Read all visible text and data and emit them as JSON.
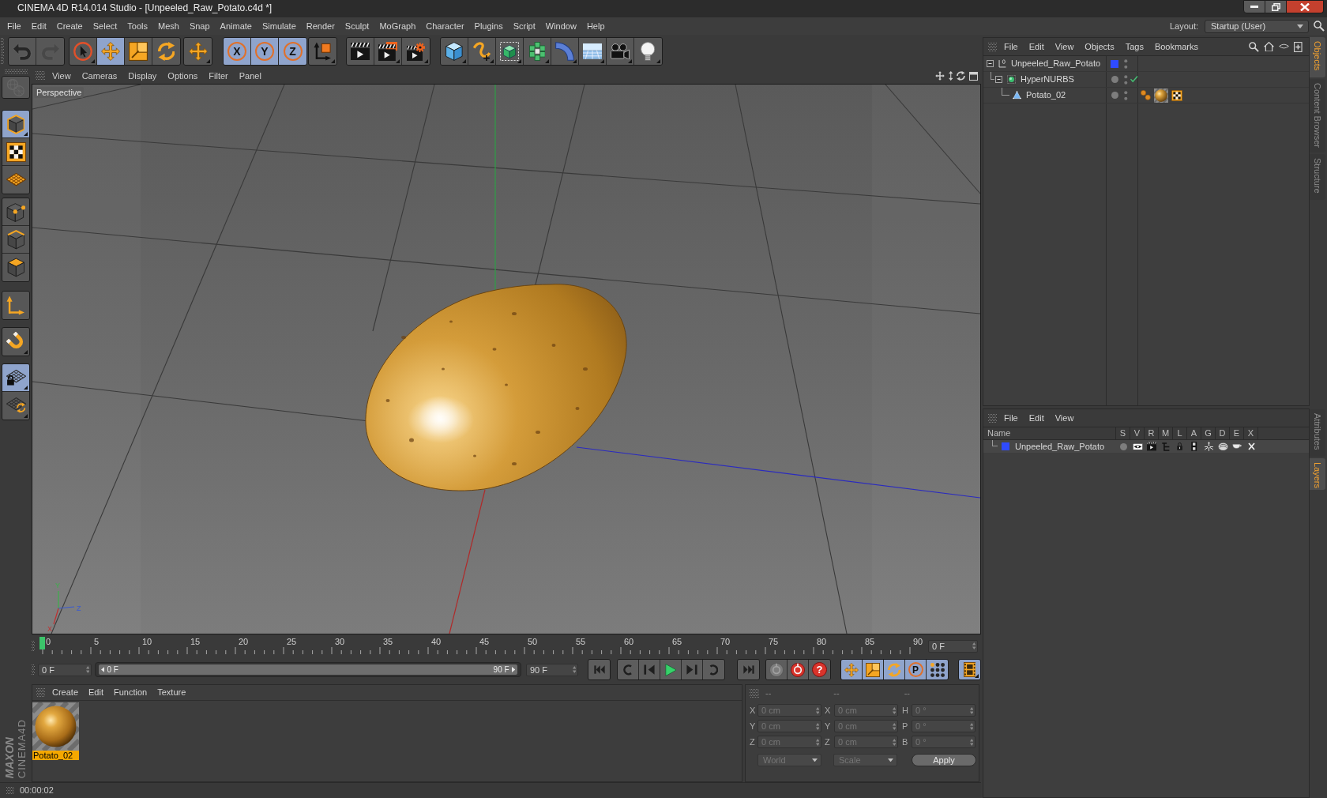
{
  "window": {
    "title": "CINEMA 4D R14.014 Studio - [Unpeeled_Raw_Potato.c4d *]"
  },
  "menu_bar": {
    "items": [
      "File",
      "Edit",
      "Create",
      "Select",
      "Tools",
      "Mesh",
      "Snap",
      "Animate",
      "Simulate",
      "Render",
      "Sculpt",
      "MoGraph",
      "Character",
      "Plugins",
      "Script",
      "Window",
      "Help"
    ],
    "layout_label": "Layout:",
    "layout_value": "Startup (User)"
  },
  "toolbar": {
    "groups": [
      [
        {
          "disabled": false
        },
        {
          "disabled": true
        }
      ],
      [
        {
          "selected": false
        },
        {
          "selected": true
        },
        {
          "selected": false
        },
        {
          "selected": false
        }
      ],
      [
        {
          "selected": false
        }
      ],
      [
        {
          "label": "X",
          "selected": true
        },
        {
          "label": "Y",
          "selected": true
        },
        {
          "label": "Z",
          "selected": true
        }
      ],
      [
        {
          "selected": false
        }
      ],
      [
        {
          "selected": false
        },
        {
          "selected": false
        },
        {
          "selected": false
        }
      ],
      [
        {
          "selected": false
        },
        {
          "selected": false
        },
        {
          "selected": false
        },
        {
          "selected": false
        },
        {
          "selected": false
        },
        {
          "selected": false
        },
        {
          "selected": false
        },
        {
          "selected": false
        }
      ]
    ]
  },
  "left_toolbar": {
    "groups": [
      [
        {
          "disabled": true
        }
      ],
      [
        {
          "selected": true
        },
        {
          "selected": false
        },
        {
          "selected": false
        }
      ],
      [
        {
          "selected": false
        },
        {
          "selected": false
        },
        {
          "selected": false
        }
      ],
      [
        {
          "selected": false
        }
      ],
      [
        {
          "selected": false
        }
      ],
      [
        {
          "selected": true
        },
        {
          "selected": false
        }
      ]
    ]
  },
  "viewport": {
    "menu": [
      "View",
      "Cameras",
      "Display",
      "Options",
      "Filter",
      "Panel"
    ],
    "camera": "Perspective",
    "gizmo_labels": [
      "Y",
      "Z",
      "X"
    ]
  },
  "timeline": {
    "ruler_labels": [
      "0",
      "5",
      "10",
      "15",
      "20",
      "25",
      "30",
      "35",
      "40",
      "45",
      "50",
      "55",
      "60",
      "65",
      "70",
      "75",
      "80",
      "85",
      "90"
    ],
    "playhead": {
      "level": 0
    },
    "current_frame": "0 F"
  },
  "transport": {
    "start_field": "0 F",
    "range": {
      "level": 1
    },
    "range_start": "0 F",
    "range_end": "90 F",
    "end_field": "90 F",
    "help_label": "?",
    "key_buttons": [
      {
        "selected": true
      },
      {
        "selected": true
      },
      {
        "selected": true
      },
      {
        "label": "P",
        "selected": true
      },
      {
        "selected": true
      }
    ],
    "timeline_button": {
      "selected": true
    }
  },
  "material_manager": {
    "menu": [
      "Create",
      "Edit",
      "Function",
      "Texture"
    ],
    "materials": [
      {
        "name": "Potato_02",
        "selected": true
      }
    ]
  },
  "coordinates": {
    "disabled": true,
    "headers": [
      "--",
      "--",
      "--"
    ],
    "rows": [
      [
        {
          "label": "X",
          "value": "0 cm"
        },
        {
          "label": "X",
          "value": "0 cm"
        },
        {
          "label": "H",
          "value": "0 °"
        }
      ],
      [
        {
          "label": "Y",
          "value": "0 cm"
        },
        {
          "label": "Y",
          "value": "0 cm"
        },
        {
          "label": "P",
          "value": "0 °"
        }
      ],
      [
        {
          "label": "Z",
          "value": "0 cm"
        },
        {
          "label": "Z",
          "value": "0 cm"
        },
        {
          "label": "B",
          "value": "0 °"
        }
      ]
    ],
    "dropdowns": [
      "World",
      "Scale"
    ],
    "apply": "Apply"
  },
  "logo": {
    "line1": "MAXON",
    "line2": "CINEMA4D"
  },
  "status_bar": {
    "text": "00:00:02"
  },
  "object_manager": {
    "menu": [
      "File",
      "Edit",
      "View",
      "Objects",
      "Tags",
      "Bookmarks"
    ],
    "objects": [
      {
        "name": "Unpeeled_Raw_Potato",
        "kind": "null",
        "color": "#2f4bff",
        "expanded": true,
        "children": [
          {
            "name": "HyperNURBS",
            "kind": "generator",
            "enabled": true,
            "expanded": true,
            "children": [
              {
                "name": "Potato_02",
                "kind": "polygon",
                "tags": [
                  {
                    "kind": "phong"
                  },
                  {
                    "kind": "material"
                  },
                  {
                    "kind": "uvw"
                  }
                ]
              }
            ]
          }
        ]
      }
    ]
  },
  "layer_manager": {
    "menu": [
      "File",
      "Edit",
      "View"
    ],
    "columns": [
      "Name",
      "S",
      "V",
      "R",
      "M",
      "L",
      "A",
      "G",
      "D",
      "E",
      "X"
    ],
    "layers": [
      {
        "name": "Unpeeled_Raw_Potato",
        "color": "#2f4bff"
      }
    ]
  },
  "side_tabs": {
    "top": [
      {
        "label": "Objects",
        "selected": true
      },
      {
        "label": "Content Browser",
        "selected": false
      },
      {
        "label": "Structure",
        "selected": false
      }
    ],
    "bottom": [
      {
        "label": "Attributes",
        "selected": false
      },
      {
        "label": "Layers",
        "selected": true
      }
    ]
  }
}
